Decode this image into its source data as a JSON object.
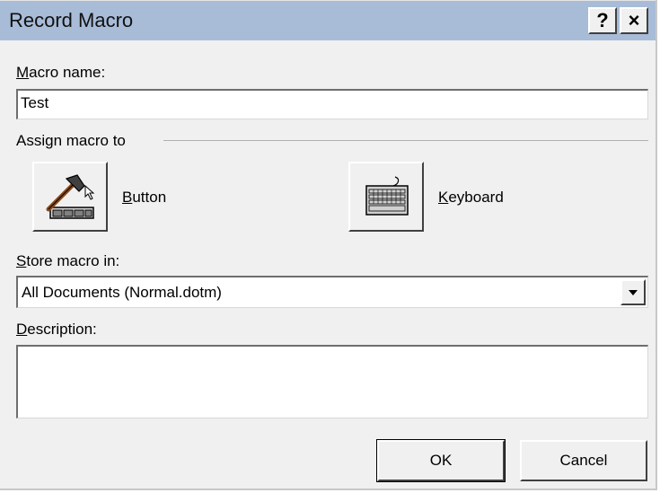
{
  "window": {
    "title": "Record Macro",
    "help_label": "?",
    "close_label": "×"
  },
  "macro_name": {
    "mnemonic": "M",
    "label_rest": "acro name:",
    "value": "Test"
  },
  "assign": {
    "group_label": "Assign macro to",
    "button": {
      "mnemonic": "B",
      "label_rest": "utton",
      "icon": "hammer-icon"
    },
    "keyboard": {
      "mnemonic": "K",
      "label_rest": "eyboard",
      "icon": "keyboard-icon"
    }
  },
  "store": {
    "mnemonic": "S",
    "label_rest": "tore macro in:",
    "selected": "All Documents (Normal.dotm)"
  },
  "description": {
    "mnemonic": "D",
    "label_rest": "escription:",
    "value": ""
  },
  "actions": {
    "ok_label": "OK",
    "cancel_label": "Cancel"
  }
}
